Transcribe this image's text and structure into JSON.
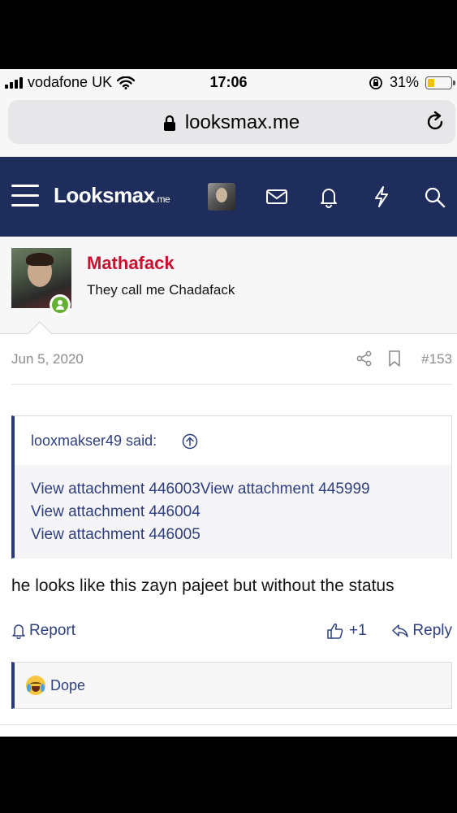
{
  "status_bar": {
    "carrier": "vodafone UK",
    "time": "17:06",
    "battery_percent": "31%",
    "battery_level": 0.31,
    "battery_color": "#f2c400"
  },
  "browser": {
    "url": "looksmax.me",
    "lock_icon": "lock-icon",
    "reload_icon": "reload-icon"
  },
  "site_nav": {
    "logo_main": "Looksmax",
    "logo_suffix": ".me",
    "background": "#1e2d5c",
    "icons": [
      "hamburger-icon",
      "avatar",
      "mail-icon",
      "bell-icon",
      "bolt-icon",
      "search-icon"
    ]
  },
  "post": {
    "username": "Mathafack",
    "username_color": "#c8102e",
    "user_title": "They call me Chadafack",
    "date": "Jun 5, 2020",
    "number": "#153",
    "quote": {
      "author_line": "looxmakser49 said:",
      "attachments": [
        "View attachment 446003View attachment 445999",
        "View attachment 446004",
        "View attachment 446005"
      ]
    },
    "text": "he looks like this zayn pajeet but without the status",
    "actions": {
      "report": "Report",
      "like": "+1",
      "reply": "Reply"
    },
    "reaction": {
      "label": "Dope",
      "emoji": "crying-laughing-emoji"
    }
  }
}
